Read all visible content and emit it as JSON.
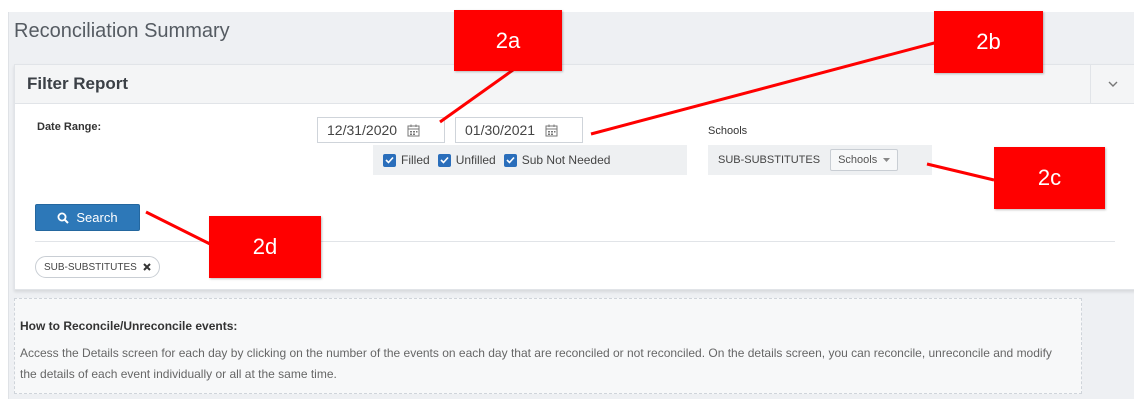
{
  "page": {
    "title": "Reconciliation Summary"
  },
  "filter_panel": {
    "title": "Filter Report",
    "collapse_icon": "chevron-down-icon",
    "date_range": {
      "label": "Date Range:",
      "start_date": "12/31/2020",
      "end_date": "01/30/2021",
      "calendar_icon": "calendar-icon"
    },
    "status_filters": [
      {
        "label": "Filled",
        "checked": true
      },
      {
        "label": "Unfilled",
        "checked": true
      },
      {
        "label": "Sub Not Needed",
        "checked": true
      }
    ],
    "schools": {
      "label": "Schools",
      "selected_group": "SUB-SUBSTITUTES",
      "dropdown_label": "Schools"
    },
    "search_button": {
      "label": "Search",
      "icon": "search-icon"
    },
    "active_tags": [
      {
        "label": "SUB-SUBSTITUTES",
        "remove_icon": "close-icon"
      }
    ]
  },
  "help": {
    "title": "How to Reconcile/Unreconcile events:",
    "body": "Access the Details screen for each day by clicking on the number of the events on each day that are reconciled or not reconciled. On the details screen, you can reconcile, unreconcile and modify the details of each event individually or all at the same time."
  },
  "annotations": [
    {
      "id": "2a",
      "label": "2a"
    },
    {
      "id": "2b",
      "label": "2b"
    },
    {
      "id": "2c",
      "label": "2c"
    },
    {
      "id": "2d",
      "label": "2d"
    }
  ],
  "colors": {
    "accent_blue": "#2d78b8",
    "checkbox_blue": "#2a6ebb",
    "annotation_red": "#ff0000",
    "page_background": "#eef0f3"
  }
}
